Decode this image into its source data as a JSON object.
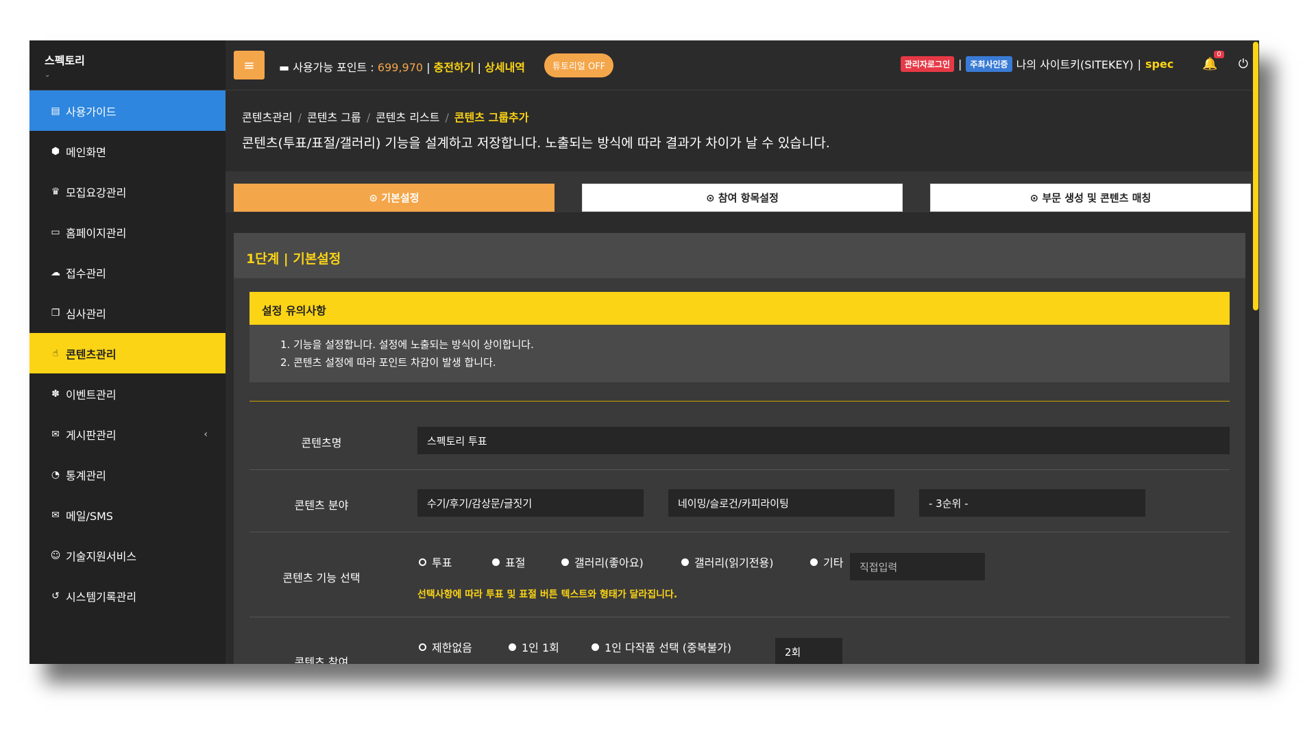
{
  "brand": {
    "name": "스펙토리",
    "caret": "⌄"
  },
  "sidebar": {
    "items": [
      {
        "label": "사용가이드",
        "icon": "book-icon",
        "glyph": "▤"
      },
      {
        "label": "메인화면",
        "icon": "cube-icon",
        "glyph": "⬢"
      },
      {
        "label": "모집요강관리",
        "icon": "trophy-icon",
        "glyph": "♛"
      },
      {
        "label": "홈페이지관리",
        "icon": "desktop-icon",
        "glyph": "▭"
      },
      {
        "label": "접수관리",
        "icon": "cloud-upload-icon",
        "glyph": "☁"
      },
      {
        "label": "심사관리",
        "icon": "copy-icon",
        "glyph": "❐"
      },
      {
        "label": "콘텐츠관리",
        "icon": "thumbs-up-icon",
        "glyph": "☝"
      },
      {
        "label": "이벤트관리",
        "icon": "gift-icon",
        "glyph": "✽"
      },
      {
        "label": "게시판관리",
        "icon": "comments-icon",
        "glyph": "✉"
      },
      {
        "label": "통계관리",
        "icon": "pie-chart-icon",
        "glyph": "◔"
      },
      {
        "label": "메일/SMS",
        "icon": "envelope-icon",
        "glyph": "✉"
      },
      {
        "label": "기술지원서비스",
        "icon": "smile-icon",
        "glyph": "☺"
      },
      {
        "label": "시스템기록관리",
        "icon": "history-icon",
        "glyph": "↺"
      }
    ],
    "chevron": "‹"
  },
  "topbar": {
    "menu_glyph": "≡",
    "points_label": "사용가능 포인트 :",
    "points_value": "699,970",
    "bar1": "|",
    "charge": "충전하기",
    "bar2": "|",
    "detail": "상세내역",
    "tutorial": "튜토리얼 OFF",
    "admin_badge": "관리자로그인",
    "host_badge": "주최사인증",
    "sitekey": "나의 사이트키(SITEKEY)",
    "sitekey_value": "spec",
    "bell_count": "0",
    "colors": {
      "accent": "#f4a64a",
      "highlight": "#fbd415",
      "guide": "#2e86de"
    }
  },
  "breadcrumb": [
    "콘텐츠관리",
    "콘텐츠 그룹",
    "콘텐츠 리스트",
    "콘텐츠 그룹추가"
  ],
  "breadcrumb_divider": "/",
  "page_desc": "콘텐츠(투표/표절/갤러리) 기능을 설계하고 저장합니다. 노출되는 방식에 따라 결과가 차이가 날 수 있습니다.",
  "steps": [
    "⊙ 기본설정",
    "⊙ 참여 항목설정",
    "⊙ 부문 생성 및 콘텐츠 매칭"
  ],
  "panel": {
    "title": "1단계 | 기본설정",
    "notice_title": "설정 유의사항",
    "notice_items": [
      "1. 기능을 설정합니다. 설정에 노출되는 방식이 상이합니다.",
      "2. 콘텐츠 설정에 따라 포인트 차감이 발생 합니다."
    ]
  },
  "form": {
    "name_label": "콘텐츠명",
    "name_value": "스펙토리 투표",
    "field_label": "콘텐츠 분야",
    "field_values": [
      "수기/후기/감상문/글짓기",
      "네이밍/슬로건/카피라이팅",
      "- 3순위 -"
    ],
    "func_label": "콘텐츠 기능 선택",
    "func_options": [
      "투표",
      "표절",
      "갤러리(좋아요)",
      "갤러리(읽기전용)",
      "기타"
    ],
    "func_custom_placeholder": "직접입력",
    "func_hint": "선택사항에 따라 투표 및 표절 버튼 텍스트와 형태가 달라집니다.",
    "join_label": "콘텐츠 참여",
    "join_options": [
      "제한없음",
      "1인 1회",
      "1인 다작품 선택 (중복불가)"
    ],
    "join_count": "2회"
  }
}
